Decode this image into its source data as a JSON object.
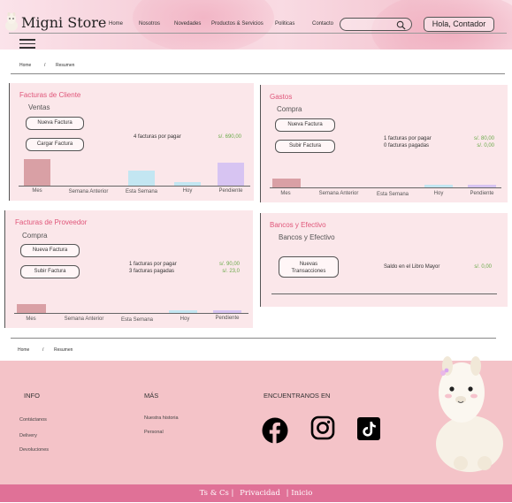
{
  "header": {
    "store_name": "Migni Store",
    "nav": [
      "Home",
      "Nosotros",
      "Novedades",
      "Productos & Servicios",
      "Politicas",
      "Contacto"
    ],
    "search_placeholder": "",
    "greeting": "Hola, Contador"
  },
  "breadcrumb_top": {
    "home": "Home",
    "sep": "/",
    "current": "Resumen"
  },
  "breadcrumb_bottom": {
    "home": "Home",
    "sep": "/",
    "current": "Resumen"
  },
  "cards": {
    "clientes": {
      "title": "Facturas de Cliente",
      "subtitle": "Ventas",
      "buttons": [
        "Nueva Factura",
        "Cargar Factura"
      ],
      "info": [
        "4 facturas por pagar"
      ],
      "amounts": [
        "s/. 690,00"
      ],
      "chart_labels": [
        "Mes",
        "Semana Anterior",
        "Esta Semana",
        "Hoy",
        "Pendiente"
      ]
    },
    "gastos": {
      "title": "Gastos",
      "subtitle": "Compra",
      "buttons": [
        "Nueva Factura",
        "Subir Factura"
      ],
      "info": [
        "1 facturas por pagar",
        "0 facturas pagadas"
      ],
      "amounts": [
        "s/. 80,00",
        "s/. 0,00"
      ],
      "chart_labels": [
        "Mes",
        "Semana Anterior",
        "Esta Semana",
        "Hoy",
        "Pendiente"
      ]
    },
    "proveedor": {
      "title": "Facturas de Proveedor",
      "subtitle": "Compra",
      "buttons": [
        "Nueva Factura",
        "Subir Factura"
      ],
      "info": [
        "1 facturas por pagar",
        "3 facturas pagadas"
      ],
      "amounts": [
        "s/. 90,00",
        "s/. 23,0"
      ],
      "chart_labels": [
        "Mes",
        "Semana Anterior",
        "Esta Semana",
        "Hoy",
        "Pendiente"
      ]
    },
    "bancos": {
      "title": "Bancos y Efectivo",
      "subtitle": "Bancos y Efectivo",
      "button_line1": "Nuevas",
      "button_line2": "Transacciones",
      "info": "Saldo en el Libro Mayor",
      "amount": "s/. 0,00"
    }
  },
  "footer": {
    "info_title": "INFO",
    "info_links": [
      "Contáctanos",
      "Delivery",
      "Devoluciones"
    ],
    "mas_title": "MÁS",
    "mas_links": [
      "Nuestra historia",
      "Personal"
    ],
    "social_title": "ENCUENTRANOS EN",
    "social_icons": [
      "facebook-icon",
      "instagram-icon",
      "tiktok-icon"
    ],
    "bottom_links": [
      "Ts & Cs |",
      "Privacidad",
      "| Inicio"
    ]
  },
  "colors": {
    "accent": "#e0567a",
    "card_bg": "#fbe7ea",
    "footer_bg": "#f4c3c8",
    "bottom_bar": "#e07197",
    "amount_green": "#6aaa4a",
    "bar_mes": "#d9a0a5",
    "bar_esta_semana": "#c3e6f2",
    "bar_hoy": "#c3e6f2",
    "bar_pendiente": "#d7c4f2"
  }
}
